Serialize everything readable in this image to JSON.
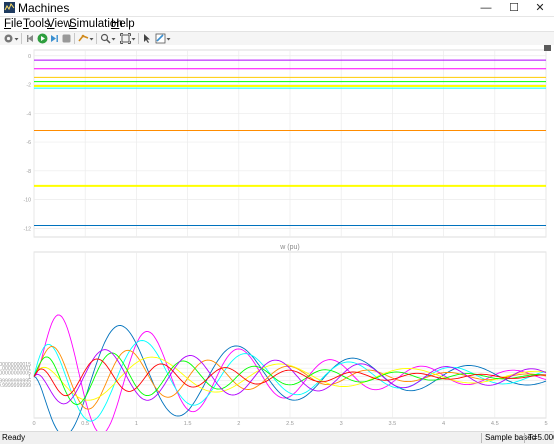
{
  "window": {
    "title": "Machines",
    "minimize_glyph": "—",
    "maximize_glyph": "☐",
    "close_glyph": "✕"
  },
  "menu": [
    {
      "mnemonic": "F",
      "rest": "ile"
    },
    {
      "mnemonic": "T",
      "rest": "ools"
    },
    {
      "mnemonic": "V",
      "rest": "iew"
    },
    {
      "mnemonic": "S",
      "rest": "imulation"
    },
    {
      "mnemonic": "H",
      "rest": "elp"
    }
  ],
  "toolbar": {
    "icons": [
      "settings-icon",
      "back-icon",
      "run-icon",
      "step-forward-icon",
      "stop-icon",
      "highlight-icon",
      "zoom-icon",
      "fit-to-view-icon",
      "cursor-measure-icon",
      "style-icon"
    ]
  },
  "status": {
    "left": "Ready",
    "mode": "Sample based",
    "time": "T=5.000"
  },
  "colors": {
    "accent": "#0072bd",
    "series": [
      "#ffff00",
      "#ff00ff",
      "#00ffff",
      "#ff0000",
      "#00ff00",
      "#0072bd",
      "#ff8c00",
      "#b000ff"
    ]
  },
  "chart_data": [
    {
      "type": "line",
      "title": "",
      "xlim": [
        0,
        5
      ],
      "ylim": [
        -12.6,
        0.4
      ],
      "grid": true,
      "y_ticks": [
        "0",
        "-2",
        "-4",
        "-6",
        "-8",
        "-10",
        "-12"
      ],
      "series": [
        {
          "color": "#b000ff",
          "values": [
            -0.3
          ]
        },
        {
          "color": "#ff00ff",
          "values": [
            -0.9
          ]
        },
        {
          "color": "#ffcc00",
          "values": [
            -1.5
          ]
        },
        {
          "color": "#00ff00",
          "values": [
            -1.8
          ]
        },
        {
          "color": "#ffff00",
          "values": [
            -2.1
          ]
        },
        {
          "color": "#00ffff",
          "values": [
            -2.25
          ]
        },
        {
          "color": "#ff8c00",
          "values": [
            -5.2
          ]
        },
        {
          "color": "#ffff00",
          "values": [
            -9.05
          ]
        },
        {
          "color": "#0072bd",
          "values": [
            -11.8
          ]
        }
      ]
    },
    {
      "type": "line",
      "title": "w (pu)",
      "xlim": [
        0,
        5
      ],
      "ylim": [
        0.9999999995,
        1.0000000015
      ],
      "grid": true,
      "x_ticks": [
        "0",
        "0.5",
        "1",
        "1.5",
        "2",
        "2.5",
        "3",
        "3.5",
        "4",
        "4.5",
        "5"
      ],
      "y_ticks": [
        "1.00000000015",
        "1.0000000001",
        "1.00000000005",
        "1",
        "0.99999999995",
        "0.9999999999"
      ],
      "series": [
        {
          "color": "#ff00ff",
          "amp": 1.0,
          "freq": 0.7,
          "phase": 0.0,
          "decay": 0.55
        },
        {
          "color": "#0072bd",
          "amp": 0.9,
          "freq": 0.55,
          "phase": 3.14,
          "decay": 0.45
        },
        {
          "color": "#00ffff",
          "amp": 0.7,
          "freq": 0.62,
          "phase": 1.2,
          "decay": 0.45
        },
        {
          "color": "#ff8c00",
          "amp": 0.55,
          "freq": 0.8,
          "phase": 0.4,
          "decay": 0.6
        },
        {
          "color": "#ffff00",
          "amp": 0.35,
          "freq": 0.5,
          "phase": 2.0,
          "decay": 0.35
        },
        {
          "color": "#00ff00",
          "amp": 0.45,
          "freq": 0.9,
          "phase": 0.9,
          "decay": 0.6
        },
        {
          "color": "#b000ff",
          "amp": 0.4,
          "freq": 0.75,
          "phase": 2.6,
          "decay": 0.3
        },
        {
          "color": "#ff0000",
          "amp": 0.3,
          "freq": 1.0,
          "phase": 1.6,
          "decay": 0.55
        }
      ]
    }
  ]
}
